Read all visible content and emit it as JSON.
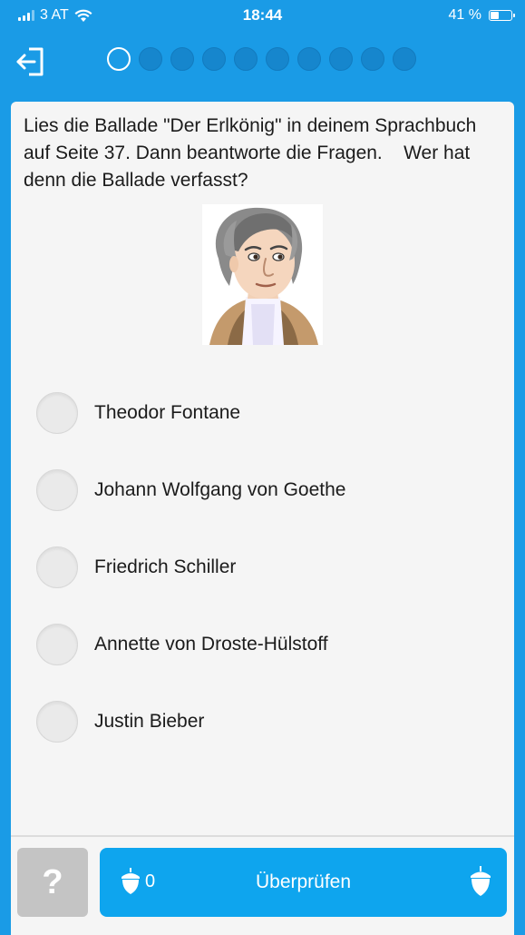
{
  "status_bar": {
    "carrier": "3 AT",
    "time": "18:44",
    "battery_percent": "41 %",
    "battery_level": 0.41
  },
  "header": {
    "progress": {
      "total": 10,
      "current": 1
    }
  },
  "quiz": {
    "question": "Lies die Ballade \"Der Erlkönig\" in deinem Sprachbuch auf Seite 37. Dann beantworte die Fragen.    Wer hat denn die Ballade verfasst?",
    "image_icon": "goethe-portrait",
    "options": [
      {
        "label": "Theodor Fontane",
        "selected": false
      },
      {
        "label": "Johann Wolfgang von Goethe",
        "selected": false
      },
      {
        "label": "Friedrich Schiller",
        "selected": false
      },
      {
        "label": "Annette von Droste-Hülstoff",
        "selected": false
      },
      {
        "label": "Justin Bieber",
        "selected": false
      }
    ]
  },
  "footer": {
    "help_label": "?",
    "check_label": "Überprüfen",
    "acorn_count": "0"
  },
  "colors": {
    "primary": "#1a9be6",
    "button": "#0ea5ee",
    "help_button": "#c4c4c4",
    "card": "#f5f5f5"
  }
}
